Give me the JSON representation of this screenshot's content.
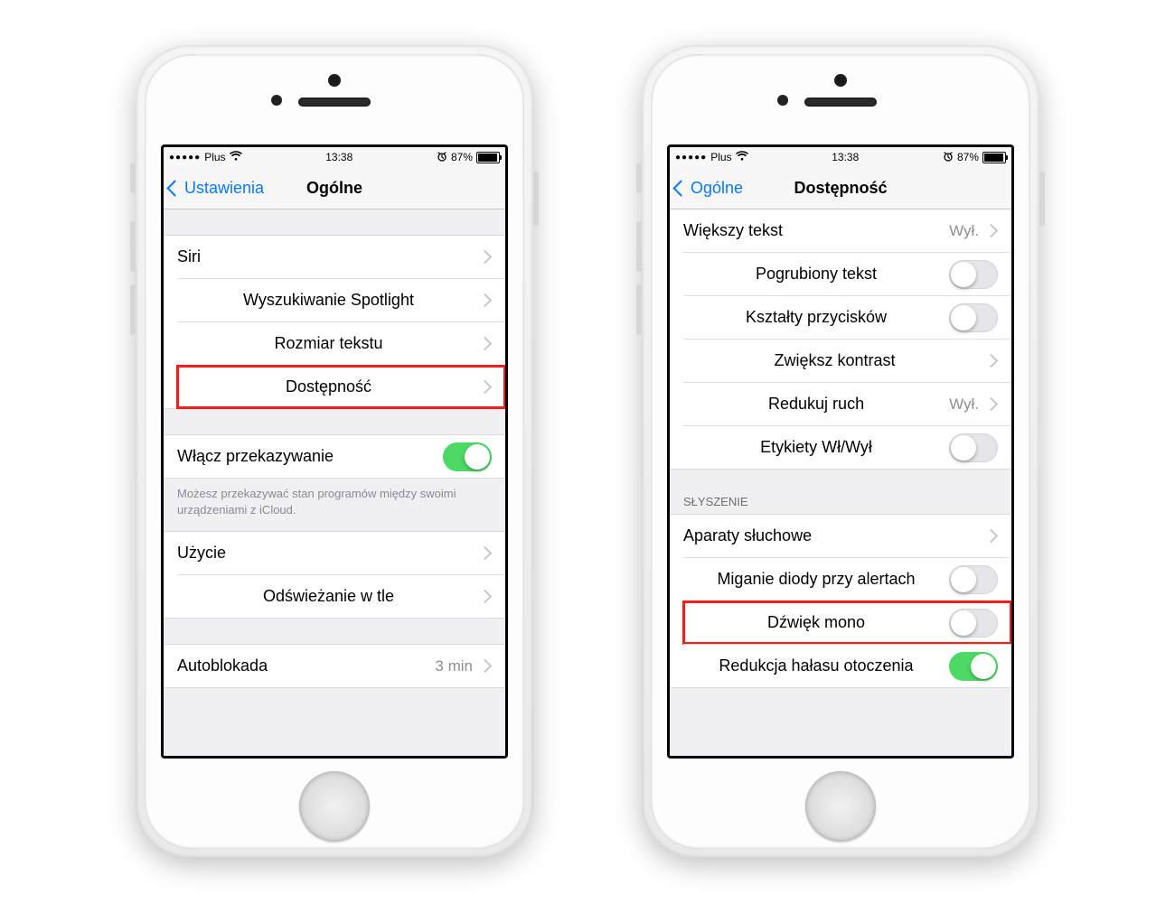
{
  "status": {
    "carrier": "Plus",
    "time": "13:38",
    "alarm_icon": "⏰",
    "battery_pct": "87%"
  },
  "phone1": {
    "back": "Ustawienia",
    "title": "Ogólne",
    "rows": {
      "siri": "Siri",
      "spotlight": "Wyszukiwanie Spotlight",
      "textsize": "Rozmiar tekstu",
      "accessibility": "Dostępność",
      "handoff": "Włącz przekazywanie",
      "handoff_note": "Możesz przekazywać stan programów między swoimi urządzeniami z iCloud.",
      "usage": "Użycie",
      "bgrefresh": "Odświeżanie w tle",
      "autolock": "Autoblokada",
      "autolock_val": "3 min"
    }
  },
  "phone2": {
    "back": "Ogólne",
    "title": "Dostępność",
    "rows": {
      "larger": "Większy tekst",
      "larger_val": "Wył.",
      "bold": "Pogrubiony tekst",
      "shapes": "Kształty przycisków",
      "contrast": "Zwiększ kontrast",
      "reduce": "Redukuj ruch",
      "reduce_val": "Wył.",
      "labels": "Etykiety Wł/Wył"
    },
    "header_hearing": "SŁYSZENIE",
    "hearing": {
      "aids": "Aparaty słuchowe",
      "led": "Miganie diody przy alertach",
      "mono": "Dźwięk mono",
      "noise": "Redukcja hałasu otoczenia"
    }
  }
}
